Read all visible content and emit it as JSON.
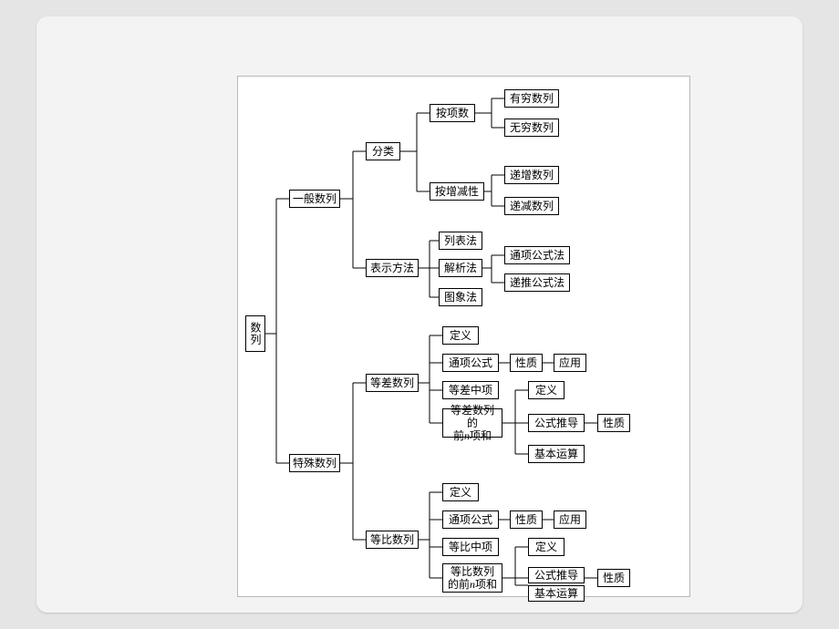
{
  "root": "数列",
  "level2": {
    "general": "一般数列",
    "special": "特殊数列"
  },
  "general": {
    "classification": {
      "label": "分类",
      "by_terms": {
        "label": "按项数",
        "finite": "有穷数列",
        "infinite": "无穷数列"
      },
      "by_monotone": {
        "label": "按增减性",
        "increasing": "递增数列",
        "decreasing": "递减数列"
      }
    },
    "representation": {
      "label": "表示方法",
      "list": "列表法",
      "analytic": {
        "label": "解析法",
        "general_term": "通项公式法",
        "recursive": "递推公式法"
      },
      "graph": "图象法"
    }
  },
  "special": {
    "arithmetic": {
      "label": "等差数列",
      "definition": "定义",
      "general_term": "通项公式",
      "property": "性质",
      "application": "应用",
      "mean": "等差中项",
      "sum_label_a": "等差数列的",
      "sum_label_b": "前n项和",
      "sum_children": {
        "definition": "定义",
        "derivation": "公式推导",
        "basic_ops": "基本运算",
        "property": "性质"
      }
    },
    "geometric": {
      "label": "等比数列",
      "definition": "定义",
      "general_term": "通项公式",
      "property": "性质",
      "application": "应用",
      "mean": "等比中项",
      "sum_label_a": "等比数列",
      "sum_label_b": "的前n项和",
      "sum_children": {
        "definition": "定义",
        "derivation": "公式推导",
        "basic_ops": "基本运算",
        "property": "性质"
      }
    }
  }
}
